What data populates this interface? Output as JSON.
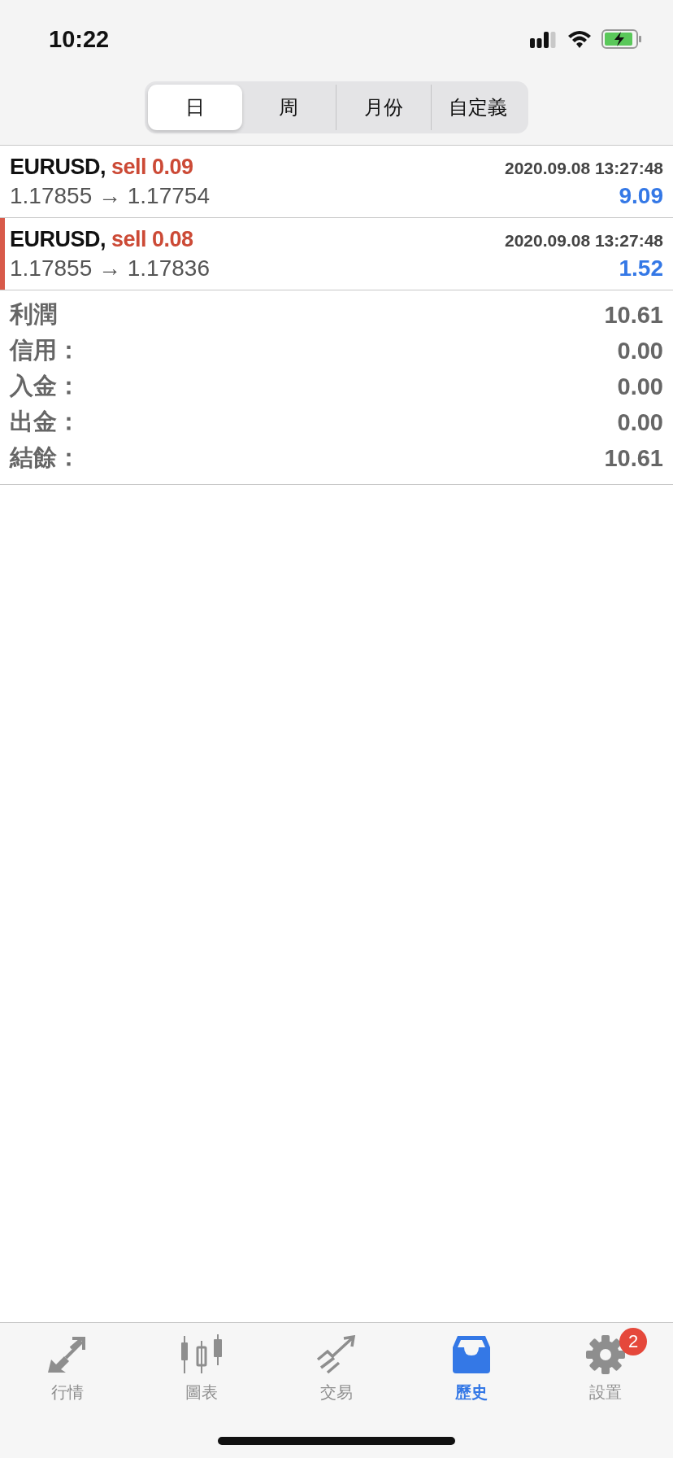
{
  "status_bar": {
    "time": "10:22"
  },
  "period_tabs": [
    {
      "label": "日",
      "selected": true
    },
    {
      "label": "周",
      "selected": false
    },
    {
      "label": "月份",
      "selected": false
    },
    {
      "label": "自定義",
      "selected": false
    }
  ],
  "trades": [
    {
      "symbol": "EURUSD,",
      "order": "sell 0.09",
      "time": "2020.09.08 13:27:48",
      "prices": "1.17855 → 1.17754",
      "profit": "9.09",
      "selected": false
    },
    {
      "symbol": "EURUSD,",
      "order": "sell 0.08",
      "time": "2020.09.08 13:27:48",
      "prices": "1.17855 → 1.17836",
      "profit": "1.52",
      "selected": true
    }
  ],
  "summary": [
    {
      "label": "利潤",
      "value": "10.61"
    },
    {
      "label": "信用：",
      "value": "0.00"
    },
    {
      "label": "入金：",
      "value": "0.00"
    },
    {
      "label": "出金：",
      "value": "0.00"
    },
    {
      "label": "結餘：",
      "value": "10.61"
    }
  ],
  "tab_bar": [
    {
      "kind": "quotes",
      "label": "行情",
      "selected": false
    },
    {
      "kind": "chart",
      "label": "圖表",
      "selected": false
    },
    {
      "kind": "trade",
      "label": "交易",
      "selected": false
    },
    {
      "kind": "history",
      "label": "歷史",
      "selected": true
    },
    {
      "kind": "settings",
      "label": "設置",
      "selected": false,
      "badge": "2"
    }
  ]
}
